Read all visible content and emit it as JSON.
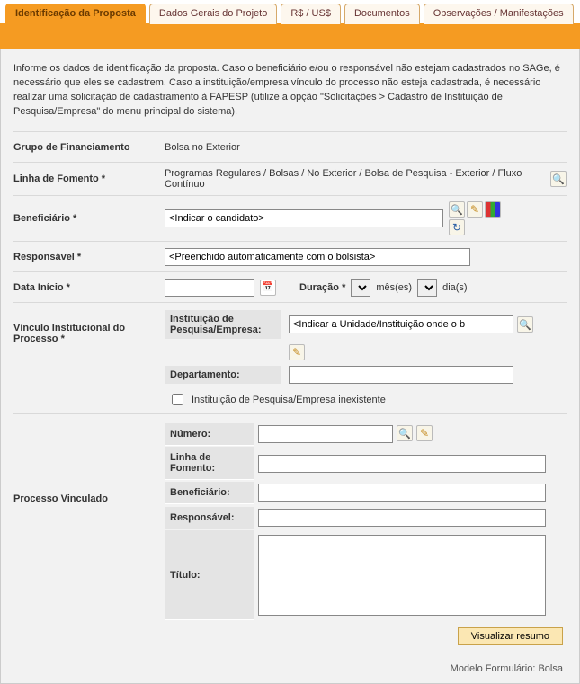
{
  "tabs": {
    "t0": "Identificação da Proposta",
    "t1": "Dados Gerais do Projeto",
    "t2": "R$ / US$",
    "t3": "Documentos",
    "t4": "Observações / Manifestações"
  },
  "intro": "Informe os dados de identificação da proposta. Caso o beneficiário e/ou o responsável não estejam cadastrados no SAGe, é necessário que eles se cadastrem. Caso a instituição/empresa vínculo do processo não esteja cadastrada, é necessário realizar uma solicitação de cadastramento à FAPESP (utilize a opção \"Solicitações > Cadastro de Instituição de Pesquisa/Empresa\" do menu principal do sistema).",
  "labels": {
    "grupo": "Grupo de Financiamento",
    "linha": "Linha de Fomento *",
    "beneficiario": "Beneficiário *",
    "responsavel": "Responsável *",
    "data_inicio": "Data Início *",
    "duracao": "Duração *",
    "meses": "mês(es)",
    "dias": "dia(s)",
    "vinculo": "Vínculo Institucional do Processo *",
    "inst": "Instituição de Pesquisa/Empresa:",
    "depto": "Departamento:",
    "inst_inexistente": "Instituição de Pesquisa/Empresa inexistente",
    "proc_vinc": "Processo Vinculado",
    "numero": "Número:",
    "linha_fomento": "Linha de Fomento:",
    "beneficiario2": "Beneficiário:",
    "responsavel2": "Responsável:",
    "titulo": "Título:",
    "visualizar": "Visualizar resumo"
  },
  "values": {
    "grupo": "Bolsa no Exterior",
    "linha": "Programas Regulares / Bolsas / No Exterior / Bolsa de Pesquisa - Exterior / Fluxo Contínuo",
    "beneficiario_ph": "<Indicar o candidato>",
    "responsavel_ph": "<Preenchido automaticamente com o bolsista>",
    "inst_ph": "<Indicar a Unidade/Instituição onde o b",
    "footer": "Modelo Formulário: Bolsa"
  }
}
